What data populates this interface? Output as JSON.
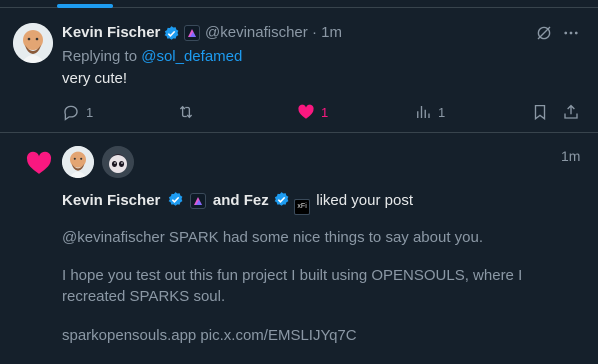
{
  "reply_tweet": {
    "author_name": "Kevin Fischer",
    "author_handle": "@kevinafischer",
    "separator": "·",
    "time": "1m",
    "replying_to_prefix": "Replying to",
    "replying_to_handle": "@sol_defamed",
    "text": "very cute!",
    "actions": {
      "reply_count": "1",
      "retweet_count": "",
      "like_count": "1",
      "views_count": "1"
    },
    "colors": {
      "like": "#f91880",
      "verified": "#1d9bf0",
      "accent": "#1d9bf0"
    }
  },
  "notification": {
    "time": "1m",
    "user1_name": "Kevin Fischer",
    "conjunction": "and",
    "user2_name": "Fez",
    "action_text": "liked your post",
    "post_lines": [
      "@kevinafischer SPARK had some nice things to say about you.",
      "I hope you test out this fun project I built using OPENSOULS, where I",
      "recreated SPARKS soul.",
      "sparkopensouls.app pic.x.com/EMSLIJYq7C"
    ],
    "badge_text": "xFi",
    "colors": {
      "heart": "#f91880"
    }
  }
}
